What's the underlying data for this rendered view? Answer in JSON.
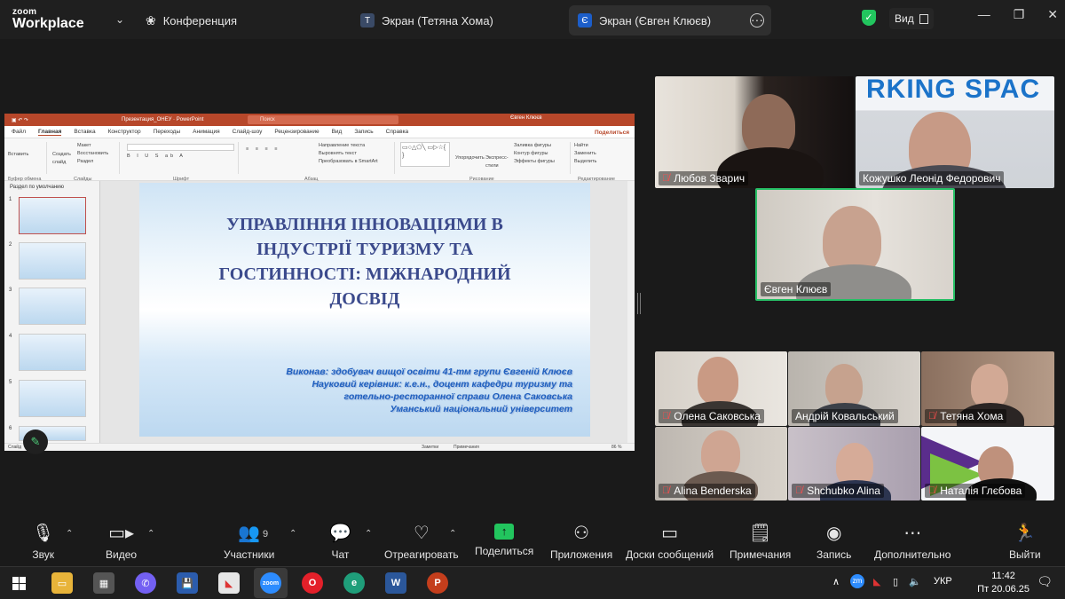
{
  "app": {
    "brand_top": "zoom",
    "brand_bottom": "Workplace"
  },
  "tabs": [
    {
      "label": "Конференция",
      "badge": ""
    },
    {
      "label": "Экран (Тетяна Хома)",
      "badge": "Т"
    },
    {
      "label": "Экран (Євген Клюєв)",
      "badge": "Є"
    }
  ],
  "view_label": "Вид",
  "powerpoint": {
    "title": "Презентация_ОНЕУ · PowerPoint",
    "search_placeholder": "Поиск",
    "user": "Євген Клюєв",
    "share_label": "Поделиться",
    "menu": [
      "Файл",
      "Главная",
      "Вставка",
      "Конструктор",
      "Переходы",
      "Анимация",
      "Слайд-шоу",
      "Рецензирование",
      "Вид",
      "Запись",
      "Справка"
    ],
    "ribbon_groups": [
      "Буфер обмена",
      "Слайды",
      "Шрифт",
      "Абзац",
      "Рисование",
      "Редактирование"
    ],
    "ribbon_items": {
      "slides": [
        "Макет",
        "Восстановить",
        "Раздел"
      ],
      "new_slide": "Создать слайд",
      "paste": "Вставить",
      "paragraph": [
        "Направление текста",
        "Выровнять текст",
        "Преобразовать в SmartArt"
      ],
      "arrange": "Упорядочить",
      "styles": "Экспресс-стили",
      "shape_props": [
        "Заливка фигуры",
        "Контур фигуры",
        "Эффекты фигуры"
      ],
      "editing": [
        "Найти",
        "Заменить",
        "Выделить"
      ]
    },
    "section_label": "Раздел по умолчанию",
    "thumb_numbers": [
      "1",
      "2",
      "3",
      "4",
      "5",
      "6"
    ],
    "slide": {
      "title": "УПРАВЛІННЯ ІННОВАЦІЯМИ В ІНДУСТРІЇ ТУРИЗМУ ТА ГОСТИННОСТІ: МІЖНАРОДНИЙ ДОСВІД",
      "info_lines": [
        "Виконав: здобувач вищої освіти 41-тм групи Євгеній Клюєв",
        "Науковий керівник: к.е.н., доцент кафедри туризму та",
        "готельно-ресторанної справи Олена Саковська",
        "Уманський національний університет"
      ]
    },
    "status": {
      "slide": "Слайд",
      "notes": "Заметки",
      "comments": "Примечания",
      "zoom": "86 %"
    }
  },
  "participants_top": [
    {
      "name": "Любов Зварич",
      "muted": true
    },
    {
      "name": "Кожушко Леонід Федорович",
      "muted": false
    },
    {
      "name": "Євген Клюєв",
      "muted": false
    }
  ],
  "participants_grid": [
    {
      "name": "Олена Саковська",
      "muted": true
    },
    {
      "name": "Андрій Ковальський",
      "muted": false
    },
    {
      "name": "Тетяна Хома",
      "muted": true
    },
    {
      "name": "Alina Benderska",
      "muted": true
    },
    {
      "name": "Shchubko Alina",
      "muted": true
    },
    {
      "name": "Наталія Глєбова",
      "muted": true
    }
  ],
  "banner_text": "RKING SPAC",
  "controls": {
    "audio": "Звук",
    "video": "Видео",
    "participants": "Участники",
    "participants_count": "9",
    "chat": "Чат",
    "react": "Отреагировать",
    "share": "Поделиться",
    "apps": "Приложения",
    "whiteboards": "Доски сообщений",
    "notes": "Примечания",
    "record": "Запись",
    "more": "Дополнительно",
    "leave": "Выйти"
  },
  "taskbar": {
    "language": "УКР",
    "time": "11:42",
    "date": "Пт 20.06.25",
    "tray_zoom": "zm"
  },
  "colors": {
    "zoom_green": "#22c55e",
    "ppt_red": "#b7472a",
    "slide_title": "#3b4a8c",
    "slide_info": "#1f5fbf",
    "muted_red": "#ff4d4d"
  }
}
